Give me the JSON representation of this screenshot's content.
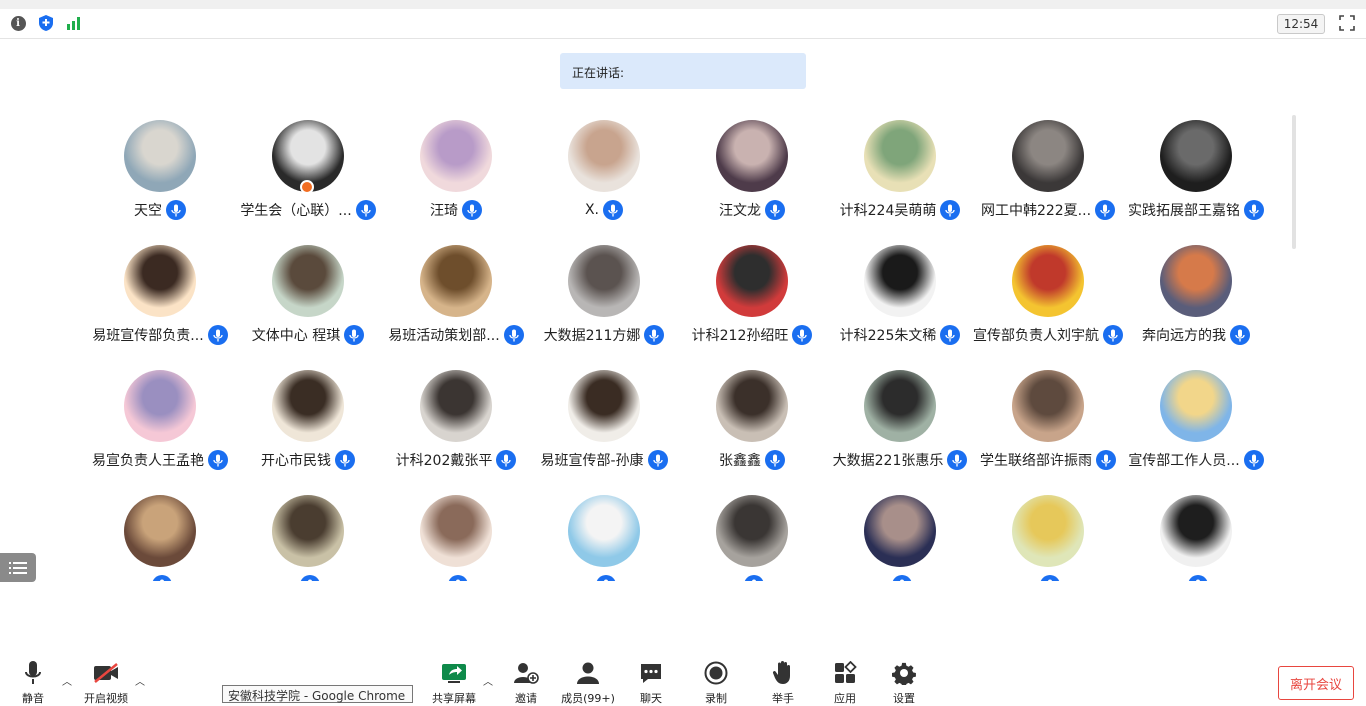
{
  "topbar": {
    "clock": "12:54"
  },
  "speaking": {
    "label": "正在讲话:"
  },
  "participants": [
    {
      "name": "天空",
      "colors": [
        "#8fa7b7",
        "#d9d6cf"
      ]
    },
    {
      "name": "学生会（心联）...",
      "colors": [
        "#2a2a2a",
        "#e3e3e3"
      ],
      "badge": true
    },
    {
      "name": "汪琦",
      "colors": [
        "#f0d9dc",
        "#b89bc8"
      ]
    },
    {
      "name": "X.",
      "colors": [
        "#e9e2dc",
        "#c8a48e"
      ]
    },
    {
      "name": "汪文龙",
      "colors": [
        "#4e3b4a",
        "#c9b2b0"
      ]
    },
    {
      "name": "计科224吴萌萌",
      "colors": [
        "#e8e0b6",
        "#7fa57a"
      ]
    },
    {
      "name": "网工中韩222夏...",
      "colors": [
        "#3b3838",
        "#8c8682"
      ]
    },
    {
      "name": "实践拓展部王嘉铭",
      "colors": [
        "#1e1e1e",
        "#6a6a6a"
      ]
    },
    {
      "name": "易班宣传部负责...",
      "colors": [
        "#fbe3c6",
        "#3b2a22"
      ]
    },
    {
      "name": "文体中心 程琪",
      "colors": [
        "#c6d6c8",
        "#5a4a3c"
      ]
    },
    {
      "name": "易班活动策划部...",
      "colors": [
        "#d6b48a",
        "#6e4e2c"
      ]
    },
    {
      "name": "大数据211方娜",
      "colors": [
        "#b8b6b5",
        "#5b5350"
      ]
    },
    {
      "name": "计科212孙绍旺",
      "colors": [
        "#d13b3b",
        "#2e2e2e"
      ]
    },
    {
      "name": "计科225朱文稀",
      "colors": [
        "#f2f2f2",
        "#1a1a1a"
      ]
    },
    {
      "name": "宣传部负责人刘宇航",
      "colors": [
        "#f4c430",
        "#c0392b"
      ]
    },
    {
      "name": "奔向远方的我",
      "colors": [
        "#5a5d7a",
        "#d67a4a"
      ]
    },
    {
      "name": "易宣负责人王孟艳",
      "colors": [
        "#f5c8d6",
        "#9a8fc0"
      ]
    },
    {
      "name": "开心市民钱",
      "colors": [
        "#efe6d8",
        "#3a2d24"
      ]
    },
    {
      "name": "计科202戴张平",
      "colors": [
        "#d8d4cf",
        "#3b3532"
      ]
    },
    {
      "name": "易班宣传部-孙康",
      "colors": [
        "#f0ede8",
        "#3a2c23"
      ]
    },
    {
      "name": "张鑫鑫",
      "colors": [
        "#c9bfb5",
        "#3b302a"
      ]
    },
    {
      "name": "大数据221张惠乐",
      "colors": [
        "#9fb1a4",
        "#2c2c2c"
      ]
    },
    {
      "name": "学生联络部许振雨",
      "colors": [
        "#c8a48a",
        "#5e4a3e"
      ]
    },
    {
      "name": "宣传部工作人员...",
      "colors": [
        "#7fb5e8",
        "#f2d68a"
      ]
    },
    {
      "name": "",
      "colors": [
        "#6b4a3a",
        "#c9a37a"
      ]
    },
    {
      "name": "",
      "colors": [
        "#c9c1a6",
        "#4a3d30"
      ]
    },
    {
      "name": "",
      "colors": [
        "#efe0d6",
        "#8a6a5a"
      ]
    },
    {
      "name": "",
      "colors": [
        "#8fc9e8",
        "#f4f4f4"
      ]
    },
    {
      "name": "",
      "colors": [
        "#a6a29d",
        "#3a3634"
      ]
    },
    {
      "name": "",
      "colors": [
        "#2b2f55",
        "#a88f8a"
      ]
    },
    {
      "name": "",
      "colors": [
        "#dfe6b8",
        "#e6c85a"
      ]
    },
    {
      "name": "",
      "colors": [
        "#f0f0f0",
        "#1e1e1e"
      ]
    }
  ],
  "toolbar": {
    "mute": "静音",
    "video": "开启视频",
    "share": "共享屏幕",
    "invite": "邀请",
    "members": "成员(99+)",
    "chat": "聊天",
    "record": "录制",
    "raise_hand": "举手",
    "apps": "应用",
    "settings": "设置",
    "leave": "离开会议"
  },
  "tooltip": "安徽科技学院 - Google Chrome",
  "colors": {
    "accent": "#1a6ef0",
    "leave": "#e8463f",
    "speaking_bg": "#dbe9fb",
    "share_green": "#0e8a4a"
  }
}
